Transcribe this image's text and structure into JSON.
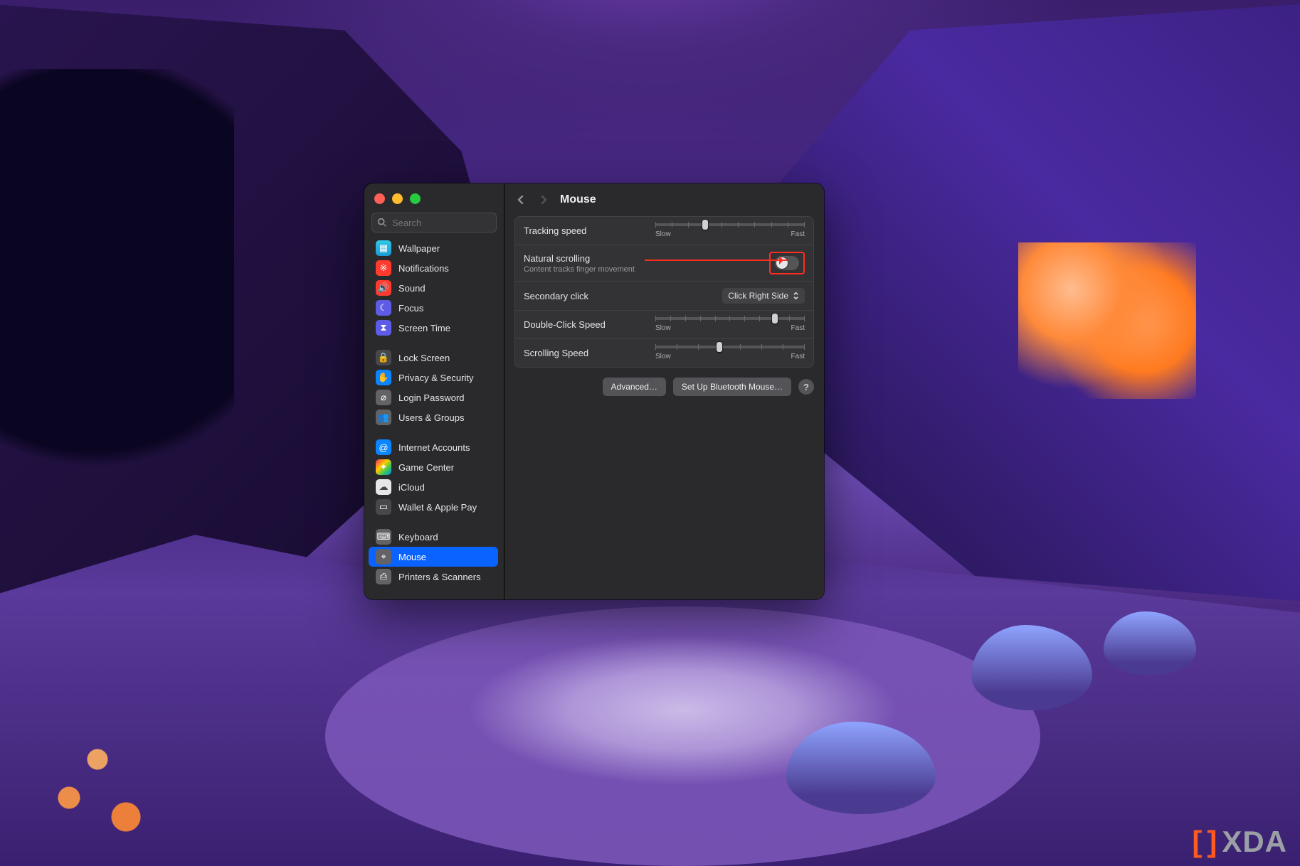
{
  "watermark": "XDA",
  "window": {
    "search_placeholder": "Search",
    "title": "Mouse",
    "nav": {
      "back_enabled": true,
      "forward_enabled": false
    }
  },
  "sidebar": {
    "groups": [
      [
        {
          "id": "wallpaper",
          "label": "Wallpaper",
          "icon": "image",
          "color": "i-teal"
        },
        {
          "id": "notif",
          "label": "Notifications",
          "icon": "bell",
          "color": "i-red"
        },
        {
          "id": "sound",
          "label": "Sound",
          "icon": "speaker",
          "color": "i-red"
        },
        {
          "id": "focus",
          "label": "Focus",
          "icon": "moon",
          "color": "i-purple"
        },
        {
          "id": "screentime",
          "label": "Screen Time",
          "icon": "hour",
          "color": "i-purple"
        }
      ],
      [
        {
          "id": "lock",
          "label": "Lock Screen",
          "icon": "lock",
          "color": "i-dark"
        },
        {
          "id": "privacy",
          "label": "Privacy & Security",
          "icon": "hand",
          "color": "i-blue"
        },
        {
          "id": "loginpw",
          "label": "Login Password",
          "icon": "key",
          "color": "i-grey"
        },
        {
          "id": "users",
          "label": "Users & Groups",
          "icon": "people",
          "color": "i-grey"
        }
      ],
      [
        {
          "id": "internet",
          "label": "Internet Accounts",
          "icon": "at",
          "color": "i-blue"
        },
        {
          "id": "gamecenter",
          "label": "Game Center",
          "icon": "game",
          "color": "i-multi"
        },
        {
          "id": "icloud",
          "label": "iCloud",
          "icon": "cloud",
          "color": "i-white"
        },
        {
          "id": "wallet",
          "label": "Wallet & Apple Pay",
          "icon": "card",
          "color": "i-dark"
        }
      ],
      [
        {
          "id": "keyboard",
          "label": "Keyboard",
          "icon": "kb",
          "color": "i-grey"
        },
        {
          "id": "mouse",
          "label": "Mouse",
          "icon": "mouse",
          "color": "i-grey",
          "selected": true
        },
        {
          "id": "printers",
          "label": "Printers & Scanners",
          "icon": "printer",
          "color": "i-grey"
        }
      ]
    ]
  },
  "settings": {
    "tracking": {
      "label": "Tracking speed",
      "min": "Slow",
      "max": "Fast",
      "ticks": 10,
      "value_index": 3
    },
    "natural": {
      "label": "Natural scrolling",
      "sub": "Content tracks finger movement",
      "on": false
    },
    "secondary": {
      "label": "Secondary click",
      "value": "Click Right Side"
    },
    "double": {
      "label": "Double-Click Speed",
      "min": "Slow",
      "max": "Fast",
      "ticks": 11,
      "value_index": 8
    },
    "scroll": {
      "label": "Scrolling Speed",
      "min": "Slow",
      "max": "Fast",
      "ticks": 8,
      "value_index": 3
    }
  },
  "footer": {
    "advanced": "Advanced…",
    "bluetooth": "Set Up Bluetooth Mouse…",
    "help_tip": "?"
  },
  "annotation": {
    "arrow": true
  }
}
